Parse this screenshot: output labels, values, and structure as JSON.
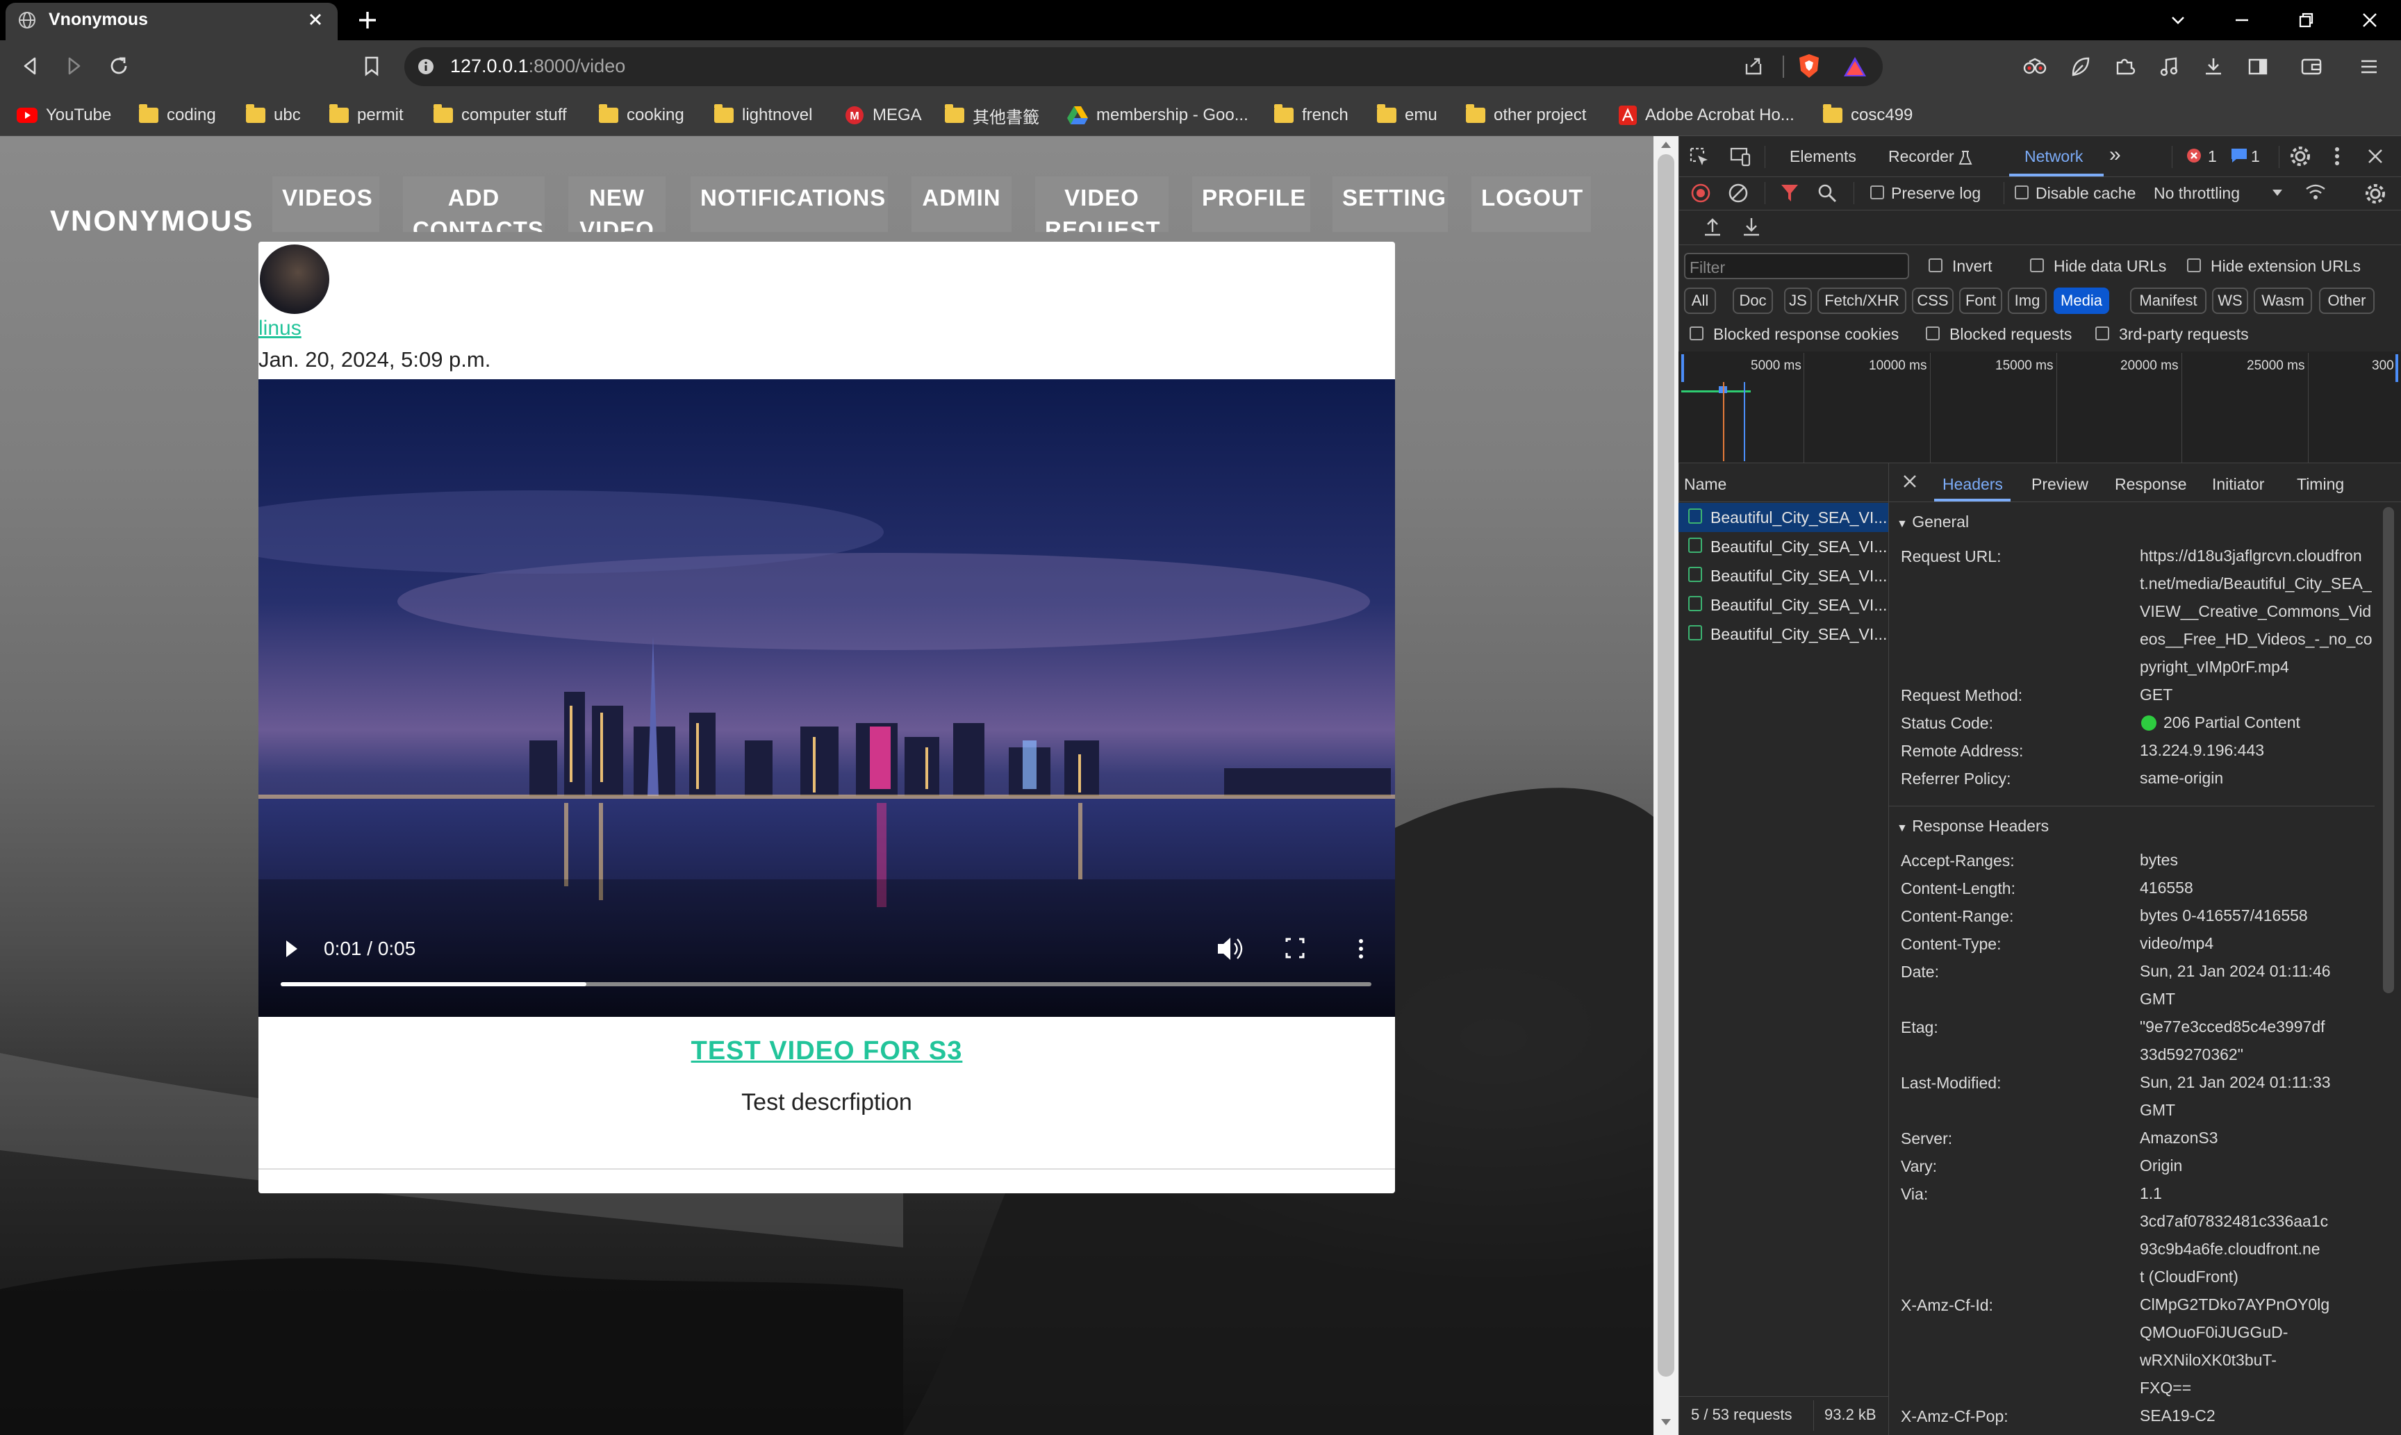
{
  "browser": {
    "tab_title": "Vnonymous",
    "url_host": "127.0.0.1",
    "url_path": ":8000/video",
    "bookmarks": [
      "YouTube",
      "coding",
      "ubc",
      "permit",
      "computer stuff",
      "cooking",
      "lightnovel",
      "MEGA",
      "其他書籤",
      "membership - Goo...",
      "french",
      "emu",
      "other project",
      "Adobe Acrobat Ho...",
      "cosc499"
    ]
  },
  "site": {
    "logo": "VNONYMOUS",
    "nav": [
      {
        "label": "VIDEOS"
      },
      {
        "label": "ADD\nCONTACTS"
      },
      {
        "label": "NEW\nVIDEO"
      },
      {
        "label": "NOTIFICATIONS"
      },
      {
        "label": "ADMIN"
      },
      {
        "label": "VIDEO\nREQUEST"
      },
      {
        "label": "PROFILE"
      },
      {
        "label": "SETTING"
      },
      {
        "label": "LOGOUT"
      }
    ]
  },
  "post": {
    "username": "linus",
    "date": "Jan. 20, 2024, 5:09 p.m.",
    "video_time": "0:01 / 0:05",
    "video_progress": 0.28,
    "title": "TEST VIDEO FOR S3",
    "description": "Test descrfiption"
  },
  "devtools": {
    "tabs": [
      "Elements",
      "Recorder",
      "Network"
    ],
    "active_tab": "Network",
    "error_count": "1",
    "message_count": "1",
    "preserve_log": "Preserve log",
    "disable_cache": "Disable cache",
    "throttling": "No throttling",
    "filter_placeholder": "Filter",
    "invert": "Invert",
    "hide_data_urls": "Hide data URLs",
    "hide_extension_urls": "Hide extension URLs",
    "type_filters": [
      "All",
      "Doc",
      "JS",
      "Fetch/XHR",
      "CSS",
      "Font",
      "Img",
      "Media",
      "Manifest",
      "WS",
      "Wasm",
      "Other"
    ],
    "active_filter": "Media",
    "blocked_response_cookies": "Blocked response cookies",
    "blocked_requests": "Blocked requests",
    "third_party_requests": "3rd-party requests",
    "timeline_ticks": [
      "5000 ms",
      "10000 ms",
      "15000 ms",
      "20000 ms",
      "25000 ms",
      "300"
    ],
    "name_header": "Name",
    "requests": [
      "Beautiful_City_SEA_VI...",
      "Beautiful_City_SEA_VI...",
      "Beautiful_City_SEA_VI...",
      "Beautiful_City_SEA_VI...",
      "Beautiful_City_SEA_VI..."
    ],
    "detail_tabs": [
      "Headers",
      "Preview",
      "Response",
      "Initiator",
      "Timing"
    ],
    "active_detail_tab": "Headers",
    "general_title": "General",
    "general": [
      {
        "key": "Request URL:",
        "value": "https://d18u3jaflgrcvn.cloudfron\nt.net/media/Beautiful_City_SEA_\nVIEW__Creative_Commons_Vid\neos__Free_HD_Videos_-_no_co\npyright_vIMp0rF.mp4"
      },
      {
        "key": "Request Method:",
        "value": "GET"
      },
      {
        "key": "Status Code:",
        "value": "206 Partial Content"
      },
      {
        "key": "Remote Address:",
        "value": "13.224.9.196:443"
      },
      {
        "key": "Referrer Policy:",
        "value": "same-origin"
      }
    ],
    "response_title": "Response Headers",
    "response_headers": [
      {
        "key": "Accept-Ranges:",
        "value": "bytes"
      },
      {
        "key": "Content-Length:",
        "value": "416558"
      },
      {
        "key": "Content-Range:",
        "value": "bytes 0-416557/416558"
      },
      {
        "key": "Content-Type:",
        "value": "video/mp4"
      },
      {
        "key": "Date:",
        "value": "Sun, 21 Jan 2024 01:11:46\nGMT"
      },
      {
        "key": "Etag:",
        "value": "\"9e77e3cced85c4e3997df\n33d59270362\""
      },
      {
        "key": "Last-Modified:",
        "value": "Sun, 21 Jan 2024 01:11:33\nGMT"
      },
      {
        "key": "Server:",
        "value": "AmazonS3"
      },
      {
        "key": "Vary:",
        "value": "Origin"
      },
      {
        "key": "Via:",
        "value": "1.1\n3cd7af07832481c336aa1c\n93c9b4a6fe.cloudfront.ne\nt (CloudFront)"
      },
      {
        "key": "X-Amz-Cf-Id:",
        "value": "ClMpG2TDko7AYPnOY0lg\nQMOuoF0iJUGGuD-\nwRXNiloXK0t3buT-\nFXQ=="
      },
      {
        "key": "X-Amz-Cf-Pop:",
        "value": "SEA19-C2"
      }
    ],
    "footer_requests": "5 / 53 requests",
    "footer_size": "93.2 kB",
    "status_color": "#2ecc40"
  }
}
